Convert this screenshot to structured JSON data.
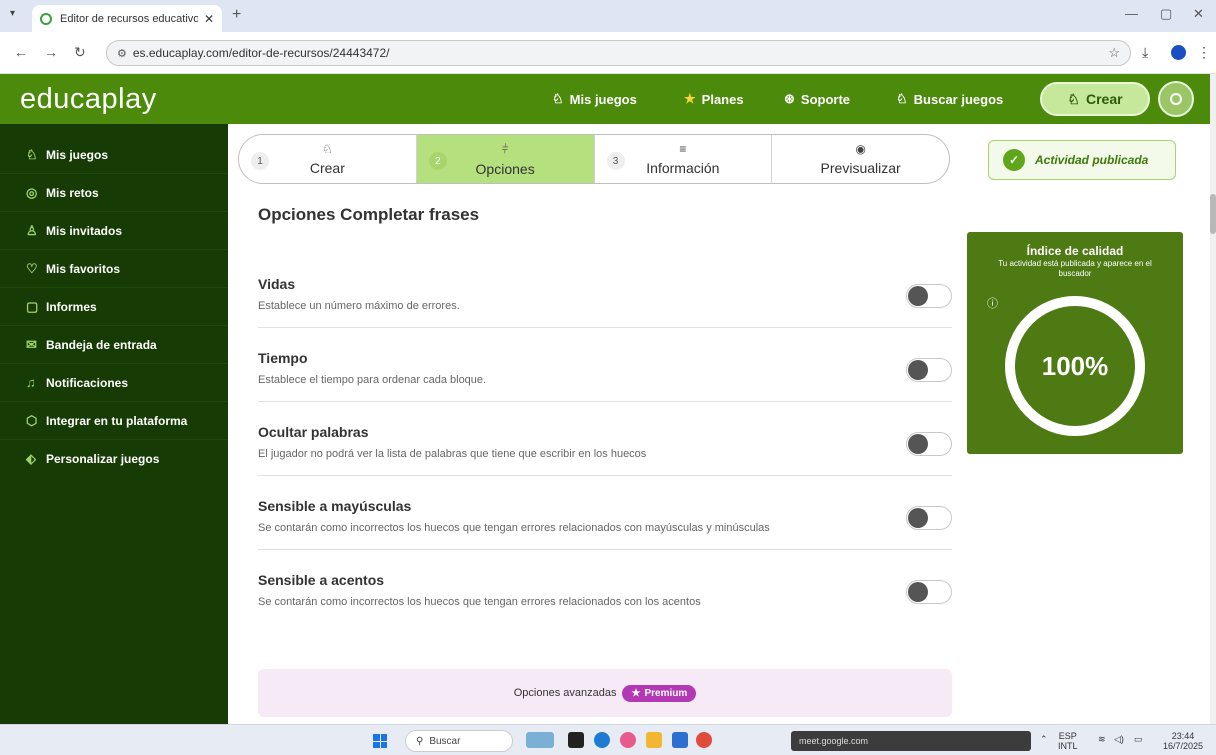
{
  "browser": {
    "tab_title": "Editor de recursos educativos: (",
    "tab_close": "✕",
    "new_tab": "+",
    "url": "es.educaplay.com/editor-de-recursos/24443472/"
  },
  "header": {
    "logo": "educaplay",
    "nav": [
      {
        "icon": "♘",
        "label": "Mis juegos"
      },
      {
        "icon": "★",
        "label": "Planes"
      },
      {
        "icon": "⊛",
        "label": "Soporte"
      },
      {
        "icon": "♘",
        "label": "Buscar juegos"
      }
    ],
    "create_label": "Crear"
  },
  "sidebar": {
    "items": [
      {
        "icon": "♘",
        "label": "Mis juegos"
      },
      {
        "icon": "◎",
        "label": "Mis retos"
      },
      {
        "icon": "♙",
        "label": "Mis invitados"
      },
      {
        "icon": "♡",
        "label": "Mis favoritos"
      },
      {
        "icon": "▢",
        "label": "Informes"
      },
      {
        "icon": "✉",
        "label": "Bandeja de entrada"
      },
      {
        "icon": "♫",
        "label": "Notificaciones"
      },
      {
        "icon": "⬡",
        "label": "Integrar en tu plataforma"
      },
      {
        "icon": "⬖",
        "label": "Personalizar juegos"
      }
    ]
  },
  "stepper": {
    "steps": [
      {
        "num": "1",
        "icon": "♘",
        "label": "Crear"
      },
      {
        "num": "2",
        "icon": "⫩",
        "label": "Opciones"
      },
      {
        "num": "3",
        "icon": "≡",
        "label": "Información"
      },
      {
        "num": "",
        "icon": "◉",
        "label": "Previsualizar"
      }
    ]
  },
  "main": {
    "section_title": "Opciones Completar frases",
    "options": [
      {
        "title": "Vidas",
        "desc": "Establece un número máximo de errores.",
        "enabled": false
      },
      {
        "title": "Tiempo",
        "desc": "Establece el tiempo para ordenar cada bloque.",
        "enabled": false
      },
      {
        "title": "Ocultar palabras",
        "desc": "El jugador no podrá ver la lista de palabras que tiene que escribir en los huecos",
        "enabled": false
      },
      {
        "title": "Sensible a mayúsculas",
        "desc": "Se contarán como incorrectos los huecos que tengan errores relacionados con mayúsculas y minúsculas",
        "enabled": false
      },
      {
        "title": "Sensible a acentos",
        "desc": "Se contarán como incorrectos los huecos que tengan errores relacionados con los acentos",
        "enabled": false
      }
    ],
    "advanced_label": "Opciones avanzadas",
    "premium_label": "Premium"
  },
  "right": {
    "published_label": "Actividad publicada",
    "quality_title": "Índice de calidad",
    "quality_subtitle": "Tu actividad está publicada y aparece en el buscador",
    "quality_value": "100%"
  },
  "taskbar": {
    "search_label": "Buscar",
    "meet_label": "meet.google.com",
    "lang": "ESP",
    "layout": "INTL",
    "time": "23:44",
    "date": "16/7/2025"
  },
  "colors": {
    "brand_green": "#4c8a0b",
    "sidebar_bg": "#163b05",
    "active_step": "#b5e07e",
    "premium": "#b338b3"
  }
}
